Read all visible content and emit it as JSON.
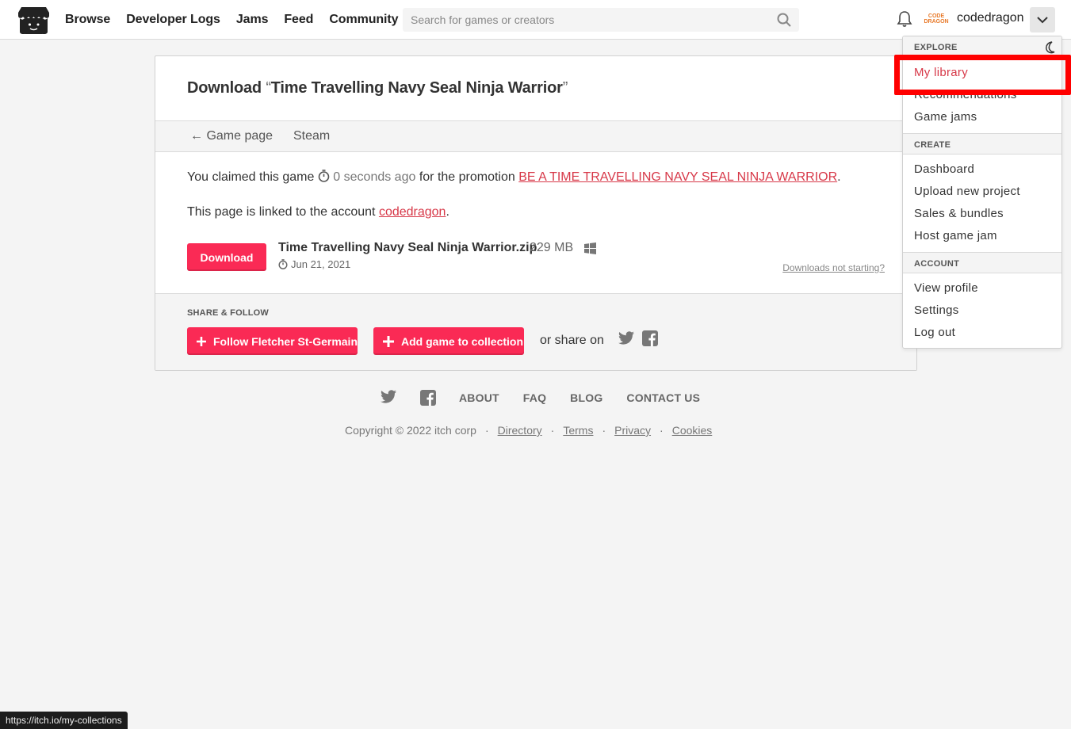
{
  "nav": {
    "items": [
      "Browse",
      "Developer Logs",
      "Jams",
      "Feed",
      "Community"
    ]
  },
  "search": {
    "placeholder": "Search for games or creators"
  },
  "user": {
    "name": "codedragon",
    "avatar_text": "CODE DRAGON"
  },
  "download": {
    "title_prefix": "Download",
    "open_quote": "“",
    "game_title": "Time Travelling Navy Seal Ninja Warrior",
    "close_quote": "”",
    "subnav": {
      "game_page": "← Game page",
      "steam": "Steam"
    },
    "claim_prefix": "You claimed this game",
    "claim_time": "0 seconds ago",
    "claim_middle": "for the promotion",
    "promotion": "BE A TIME TRAVELLING NAVY SEAL NINJA WARRIOR",
    "linked_prefix": "This page is linked to the account",
    "linked_account": "codedragon",
    "button": "Download",
    "file_name": "Time Travelling Navy Seal Ninja Warrior.zip",
    "file_size": "229 MB",
    "file_date": "Jun 21, 2021",
    "help_link": "Downloads not starting?"
  },
  "share": {
    "heading": "SHARE & FOLLOW",
    "follow": "Follow Fletcher St-Germain",
    "add_collection": "Add game to collection",
    "share_on": "or share on"
  },
  "footer": {
    "links": [
      "ABOUT",
      "FAQ",
      "BLOG",
      "CONTACT US"
    ],
    "copyright": "Copyright © 2022 itch corp",
    "legal": [
      "Directory",
      "Terms",
      "Privacy",
      "Cookies"
    ]
  },
  "dropdown": {
    "explore_heading": "EXPLORE",
    "explore": [
      "My library",
      "Recommendations",
      "Game jams"
    ],
    "create_heading": "CREATE",
    "create": [
      "Dashboard",
      "Upload new project",
      "Sales & bundles",
      "Host game jam"
    ],
    "account_heading": "ACCOUNT",
    "account": [
      "View profile",
      "Settings",
      "Log out"
    ]
  },
  "statusbar": {
    "url": "https://itch.io/my-collections"
  },
  "colors": {
    "accent": "#fa2a55",
    "link": "#d73848",
    "highlight": "#ff0000"
  }
}
